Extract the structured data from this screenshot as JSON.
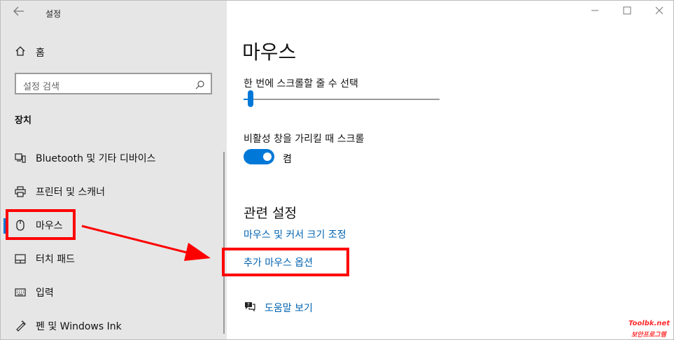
{
  "window": {
    "title": "설정",
    "controls": [
      "minimize",
      "maximize",
      "close"
    ]
  },
  "sidebar": {
    "home_label": "홈",
    "search_placeholder": "설정 검색",
    "section_label": "장치",
    "items": [
      {
        "label": "Bluetooth 및 기타 디바이스",
        "icon": "bluetooth-device-icon",
        "active": false
      },
      {
        "label": "프린터 및 스캐너",
        "icon": "printer-icon",
        "active": false
      },
      {
        "label": "마우스",
        "icon": "mouse-icon",
        "active": true
      },
      {
        "label": "터치 패드",
        "icon": "touchpad-icon",
        "active": false
      },
      {
        "label": "입력",
        "icon": "keyboard-icon",
        "active": false
      },
      {
        "label": "펜 및 Windows Ink",
        "icon": "pen-icon",
        "active": false
      }
    ]
  },
  "main": {
    "title": "마우스",
    "scroll_label": "한 번에 스크롤할 줄 수 선택",
    "scroll_lines_value": 3,
    "inactive_scroll_label": "비활성 창을 가리킬 때 스크롤",
    "inactive_scroll_state": "켬",
    "related_heading": "관련 설정",
    "links": {
      "cursor_size": "마우스 및 커서 크기 조정",
      "additional_options": "추가 마우스 옵션"
    },
    "help_label": "도움말 보기"
  },
  "watermark": {
    "line1": "Toolbk.net",
    "line2": "보안프로그램"
  },
  "colors": {
    "accent": "#0078d7",
    "link": "#0063b1",
    "annotation_red": "#ff0000",
    "sidebar_bg": "#e6e6e6"
  }
}
